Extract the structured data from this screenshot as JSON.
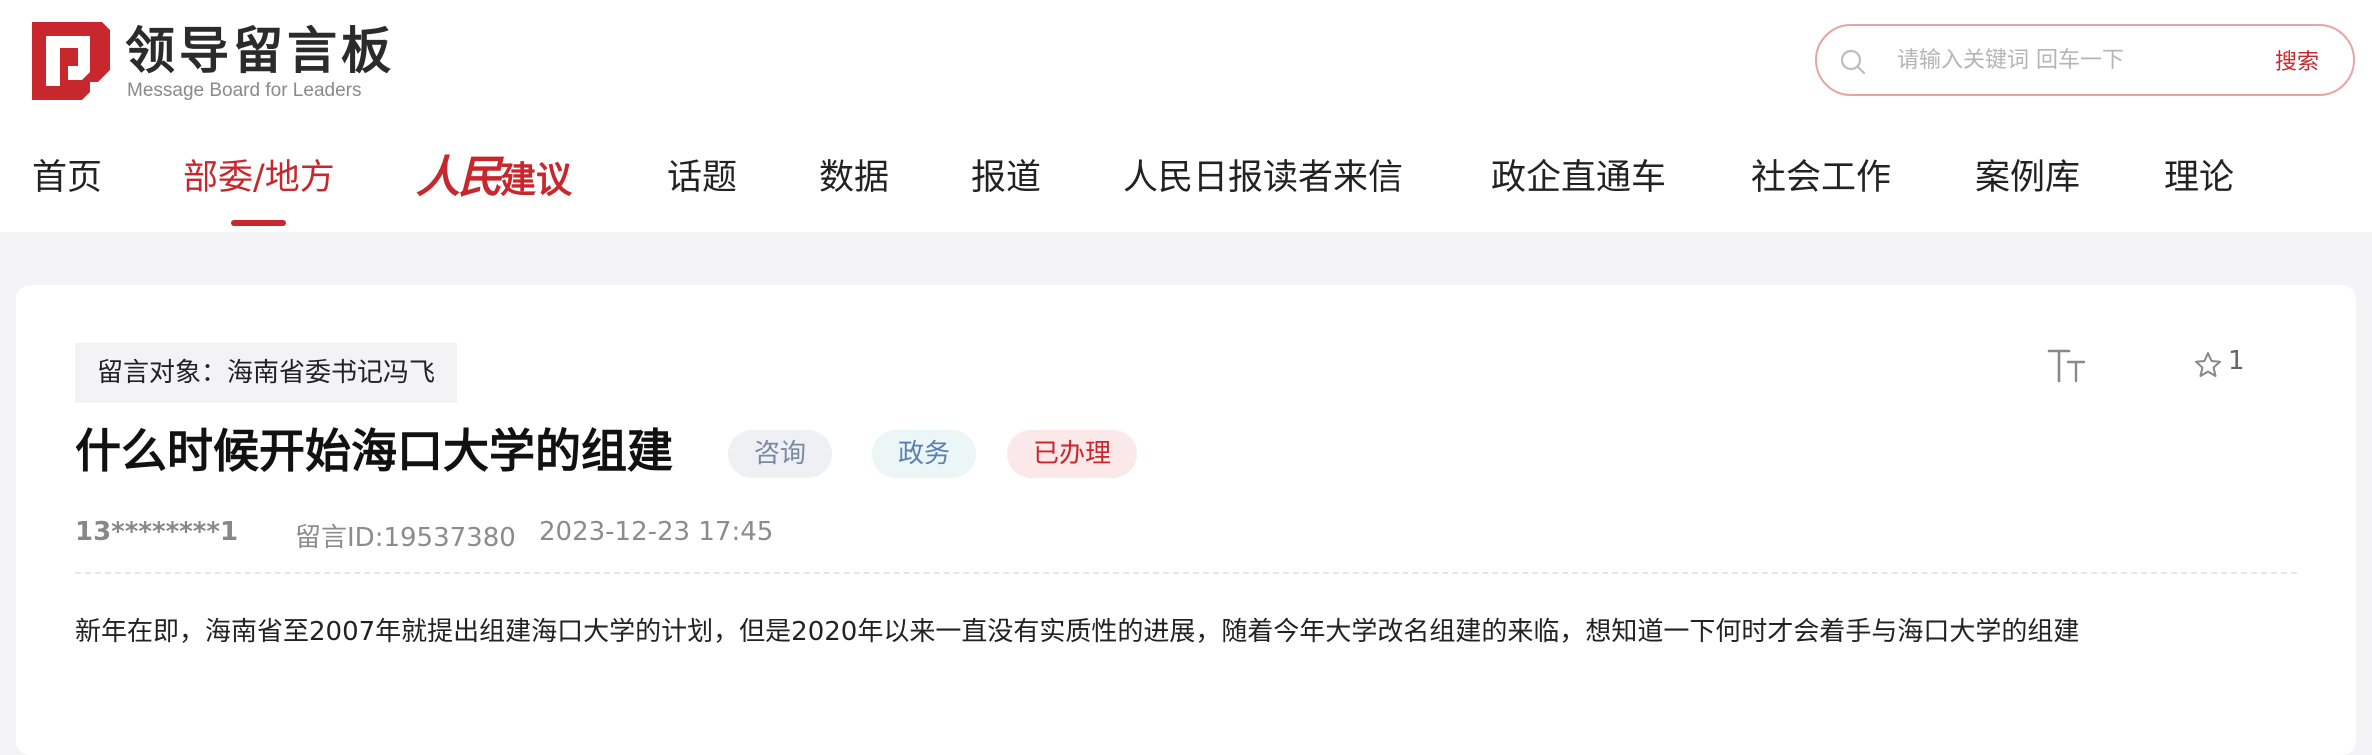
{
  "header": {
    "logo_cn": "领导留言板",
    "logo_en": "Message Board for Leaders",
    "search_placeholder": "请输入关键词 回车一下",
    "search_button": "搜索"
  },
  "nav": {
    "items": [
      "首页",
      "部委/地方",
      "人民建议",
      "话题",
      "数据",
      "报道",
      "人民日报读者来信",
      "政企直通车",
      "社会工作",
      "案例库",
      "理论"
    ],
    "brand_part1": "人民",
    "brand_part2": "建议",
    "active": "部委/地方"
  },
  "message": {
    "target": "留言对象：海南省委书记冯飞",
    "title": "什么时候开始海口大学的组建",
    "badges": [
      "咨询",
      "政务",
      "已办理"
    ],
    "user": "13********1",
    "id_text": "留言ID:19537380",
    "time": "2023-12-23 17:45",
    "star_count": "1",
    "content": "新年在即，海南省至2007年就提出组建海口大学的计划，但是2020年以来一直没有实质性的进展，随着今年大学改名组建的来临，想知道一下何时才会着手与海口大学的组建"
  },
  "colors": {
    "accent": "#c8282d",
    "badge_consult_bg": "#eef0f4",
    "badge_gov_bg": "#ecf6f6",
    "badge_done_bg": "#fbe9ea"
  },
  "icons": [
    "logo-mark-icon",
    "search-icon",
    "font-size-icon",
    "star-icon"
  ]
}
